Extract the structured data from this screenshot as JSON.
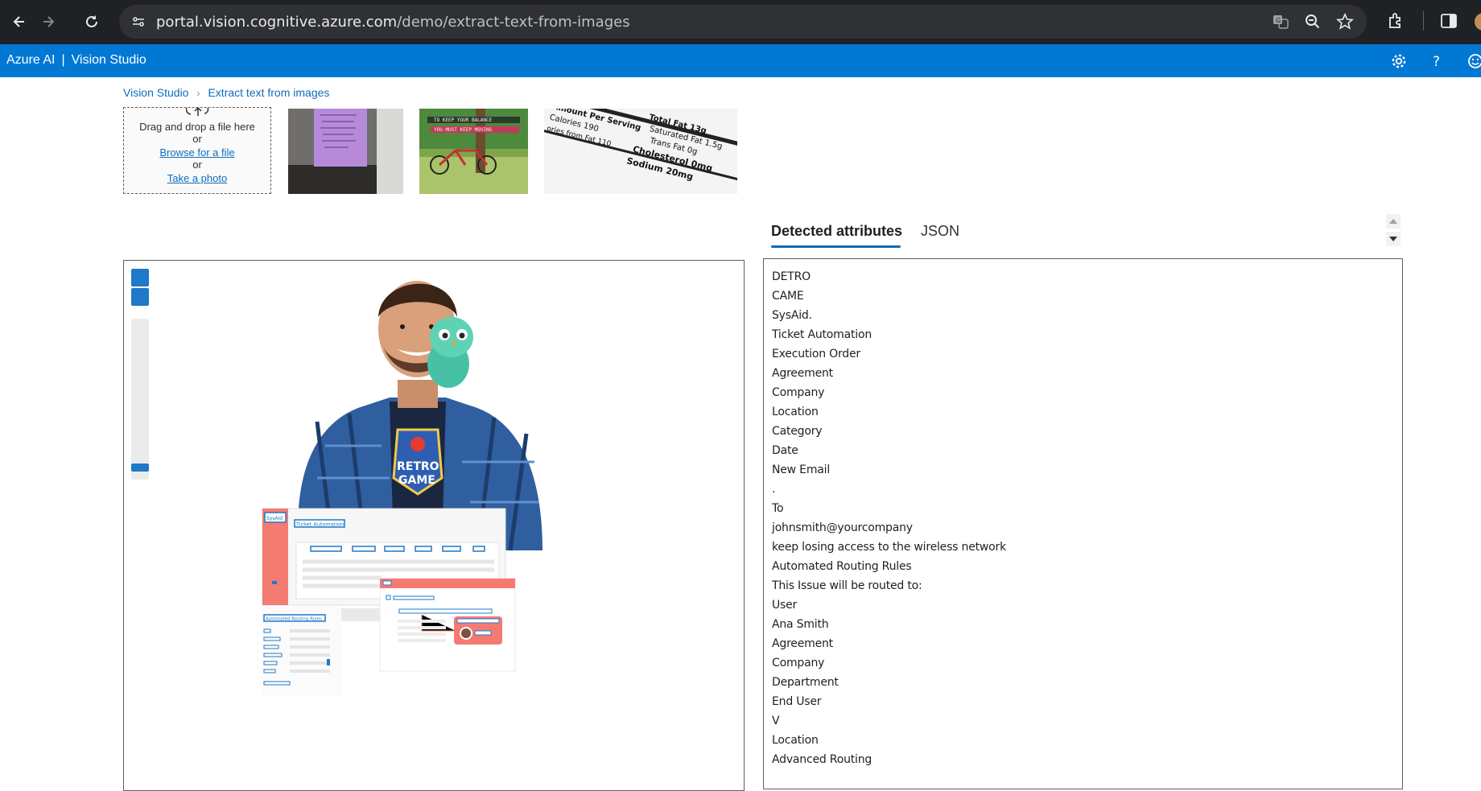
{
  "browser": {
    "url_host": "portal.vision.cognitive.azure.com",
    "url_path": "/demo/extract-text-from-images"
  },
  "header": {
    "brand": "Azure AI",
    "separator": "|",
    "product": "Vision Studio"
  },
  "breadcrumb": {
    "home": "Vision Studio",
    "current": "Extract text from images"
  },
  "upload": {
    "drag_text": "Drag and drop a file here",
    "or_1": "or",
    "browse_link": "Browse for a file",
    "or_2": "or",
    "photo_link": "Take a photo"
  },
  "samples": {
    "bike_caption_1": "TO KEEP YOUR BALANCE",
    "bike_caption_2": "YOU MUST KEEP MOVING",
    "nutrition_lines": [
      "Amount Per Serving",
      "Calories 190",
      "ories from Fat 110",
      "Total Fat 13g",
      "Saturated Fat 1.5g",
      "Trans Fat 0g",
      "Cholesterol 0mg",
      "Sodium 20mg"
    ]
  },
  "preview": {
    "shirt_text_1": "RETRO",
    "shirt_text_2": "GAME",
    "app_logo": "SysAid",
    "app_title": "Ticket Automation",
    "routing_title": "Automated Routing Rules"
  },
  "tabs": {
    "detected": "Detected attributes",
    "json": "JSON"
  },
  "results": [
    "DETRO",
    "CAME",
    "SysAid.",
    "Ticket Automation",
    "Execution Order",
    "Agreement",
    "Company",
    "Location",
    "Category",
    "Date",
    "New Email",
    ".",
    "To",
    "johnsmith@yourcompany",
    "keep losing access to the wireless network",
    "Automated Routing Rules",
    "This Issue will be routed to:",
    "User",
    "Ana Smith",
    "Agreement",
    "Company",
    "Department",
    "End User",
    "V",
    "Location",
    "Advanced Routing"
  ],
  "colors": {
    "azure_blue": "#0078d4",
    "link": "#0f6cbd",
    "chrome_dark": "#202124",
    "ocr_box": "#1f78c8",
    "salmon": "#f47b72"
  }
}
